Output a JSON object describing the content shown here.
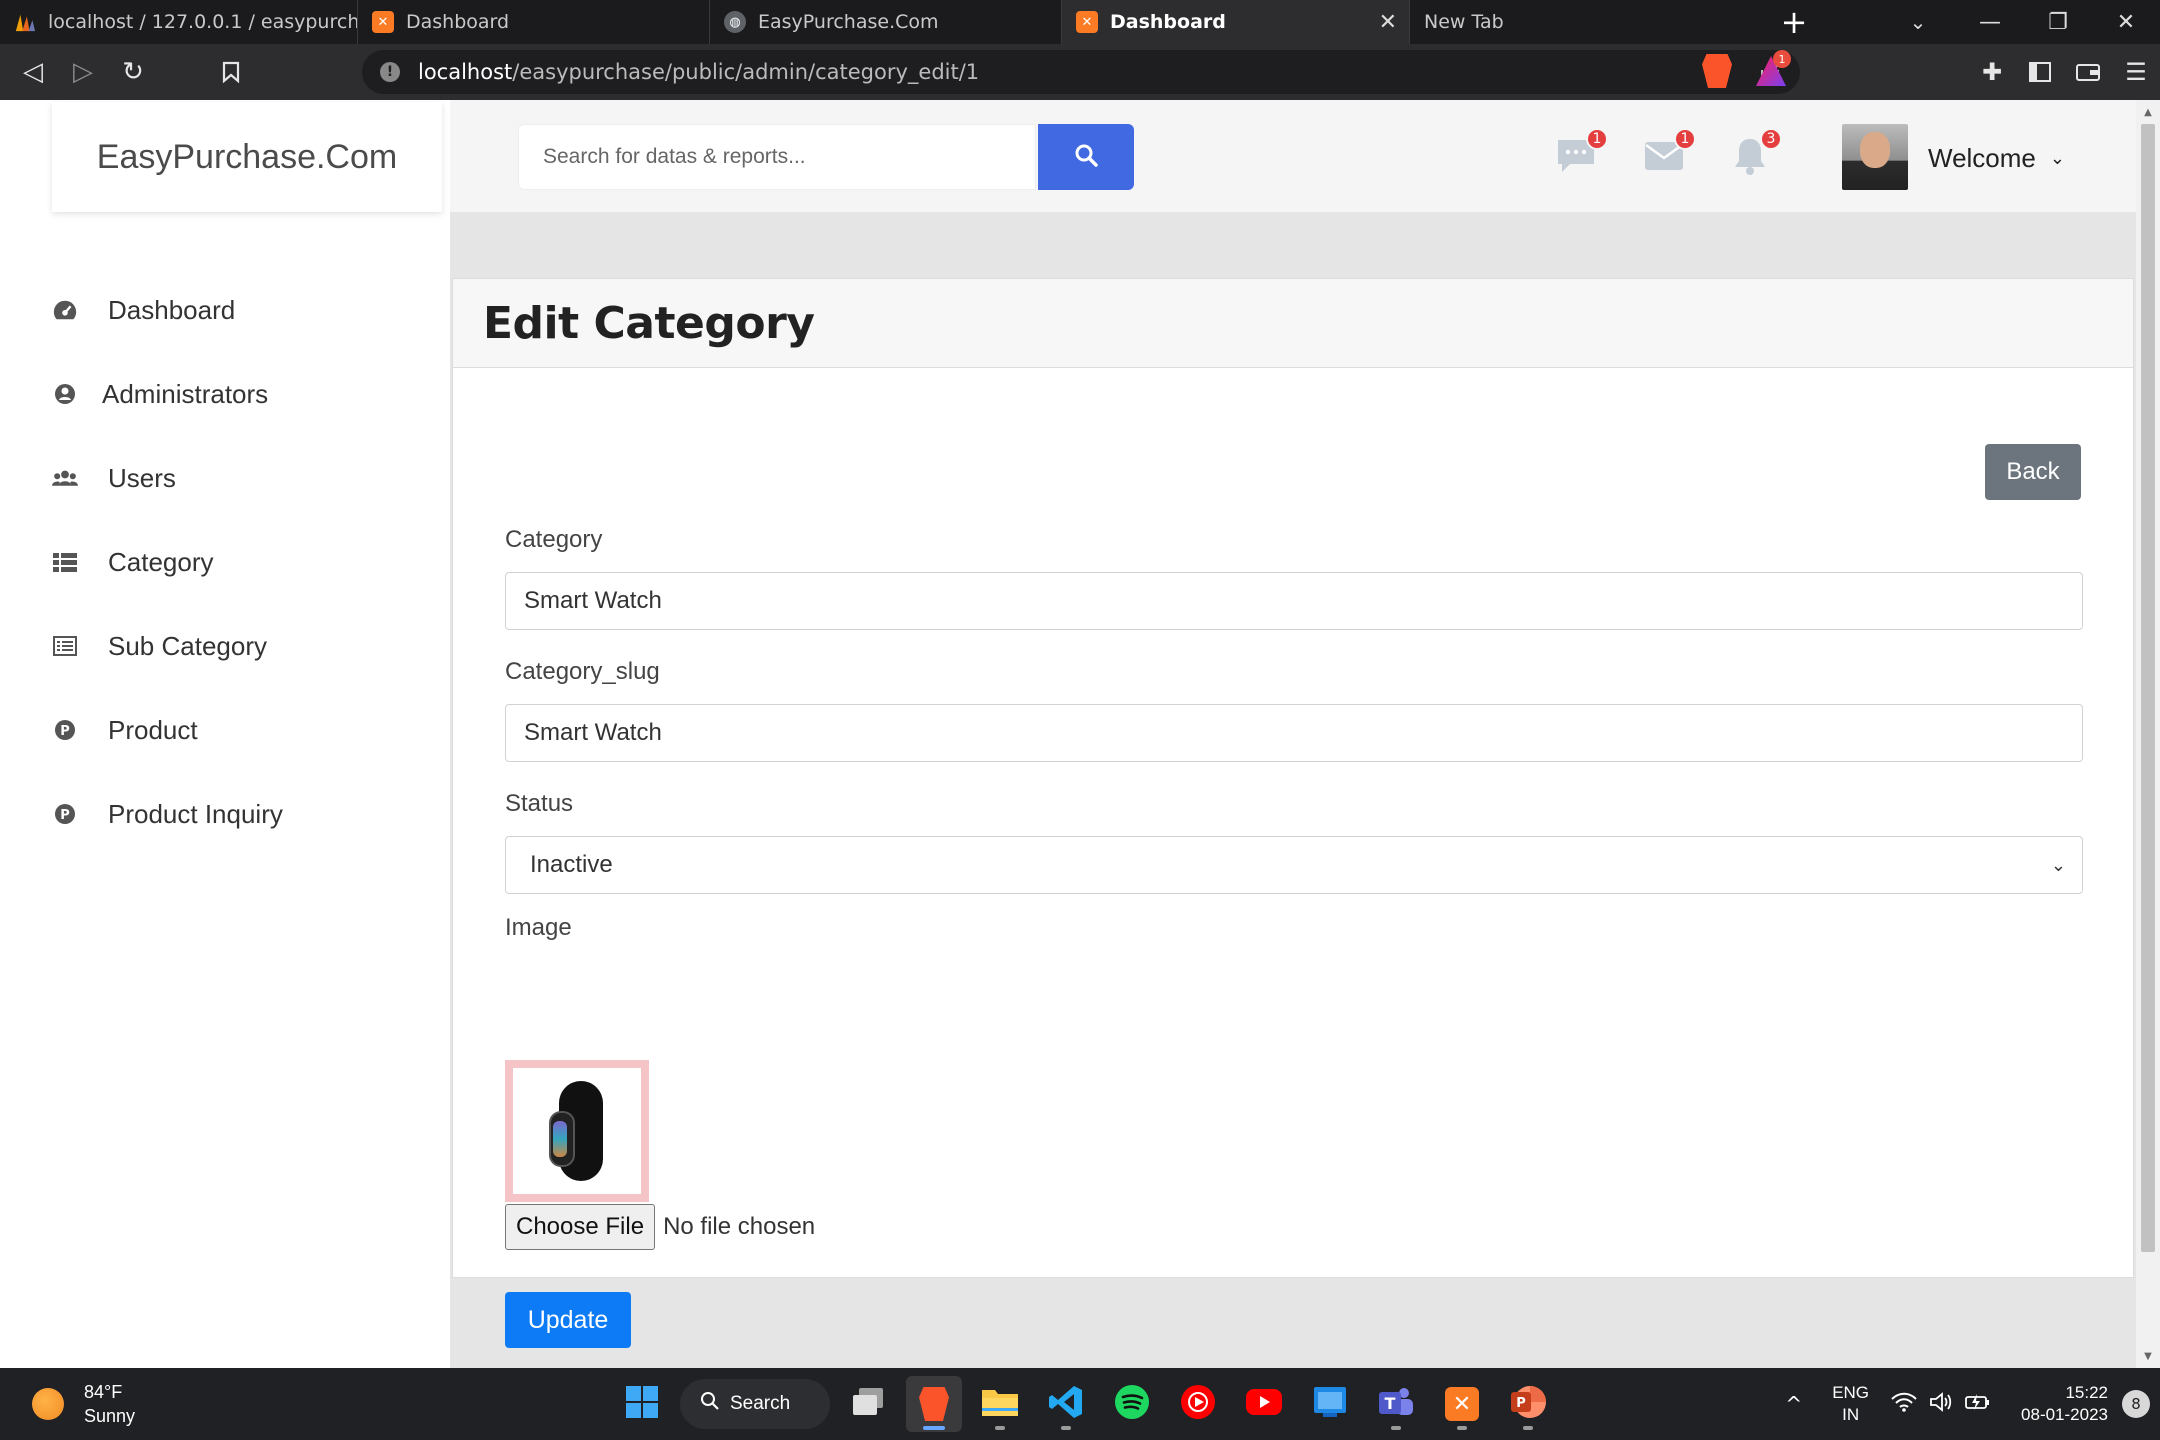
{
  "browser": {
    "tabs": [
      {
        "label": "localhost / 127.0.0.1 / easypurchase /",
        "active": false,
        "icon": "phpmyadmin-icon"
      },
      {
        "label": "Dashboard",
        "active": false,
        "icon": "xampp-icon"
      },
      {
        "label": "EasyPurchase.Com",
        "active": false,
        "icon": "globe-icon"
      },
      {
        "label": "Dashboard",
        "active": true,
        "icon": "xampp-icon"
      },
      {
        "label": "New Tab",
        "active": false,
        "icon": ""
      }
    ],
    "url_host": "localhost",
    "url_path": "/easypurchase/public/admin/category_edit/1",
    "brave_rewards_badge": "1"
  },
  "app": {
    "brand": "EasyPurchase.Com",
    "search_placeholder": "Search for datas & reports...",
    "badges": {
      "messages": "1",
      "mail": "1",
      "notifications": "3"
    },
    "user_menu_label": "Welcome"
  },
  "sidebar": {
    "items": [
      {
        "label": "Dashboard",
        "icon": "tachometer-icon"
      },
      {
        "label": "Administrators",
        "icon": "user-circle-icon"
      },
      {
        "label": "Users",
        "icon": "users-icon"
      },
      {
        "label": "Category",
        "icon": "list-icon"
      },
      {
        "label": "Sub Category",
        "icon": "list-alt-icon"
      },
      {
        "label": "Product",
        "icon": "product-p-icon"
      },
      {
        "label": "Product Inquiry",
        "icon": "product-p-icon"
      }
    ]
  },
  "form": {
    "title": "Edit Category",
    "back_label": "Back",
    "category_label": "Category",
    "category_value": "Smart Watch",
    "slug_label": "Category_slug",
    "slug_value": "Smart Watch",
    "status_label": "Status",
    "status_value": "Inactive",
    "image_label": "Image",
    "choose_file_label": "Choose File",
    "file_status": "No file chosen",
    "update_label": "Update"
  },
  "taskbar": {
    "temperature": "84°F",
    "condition": "Sunny",
    "search_label": "Search",
    "lang_top": "ENG",
    "lang_bottom": "IN",
    "time": "15:22",
    "date": "08-01-2023",
    "notification_count": "8"
  }
}
